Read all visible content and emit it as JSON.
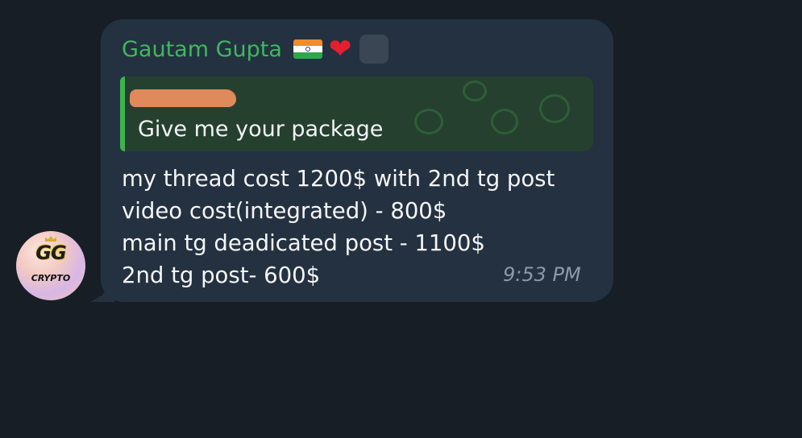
{
  "sender": {
    "name": "Gautam Gupta",
    "flag_icon": "india-flag-icon",
    "heart_icon": "red-heart-icon",
    "badge_icon": "custom-emoji-placeholder-icon"
  },
  "avatar": {
    "logo_top": "GG",
    "logo_bottom": "CRYPTO"
  },
  "reply": {
    "text": "Give me your package",
    "accent_color": "#3fb34f"
  },
  "message": {
    "lines": [
      "my thread cost 1200$ with 2nd tg post",
      "video cost(integrated) - 800$",
      "main tg deadicated post - 1100$",
      "2nd tg post- 600$"
    ],
    "time": "9:53 PM"
  },
  "colors": {
    "background": "#171e26",
    "bubble": "#243140",
    "sender_name": "#3fb85e",
    "text": "#f4f6f8",
    "timestamp": "#8c9aa8",
    "redaction": "#e0895a"
  }
}
